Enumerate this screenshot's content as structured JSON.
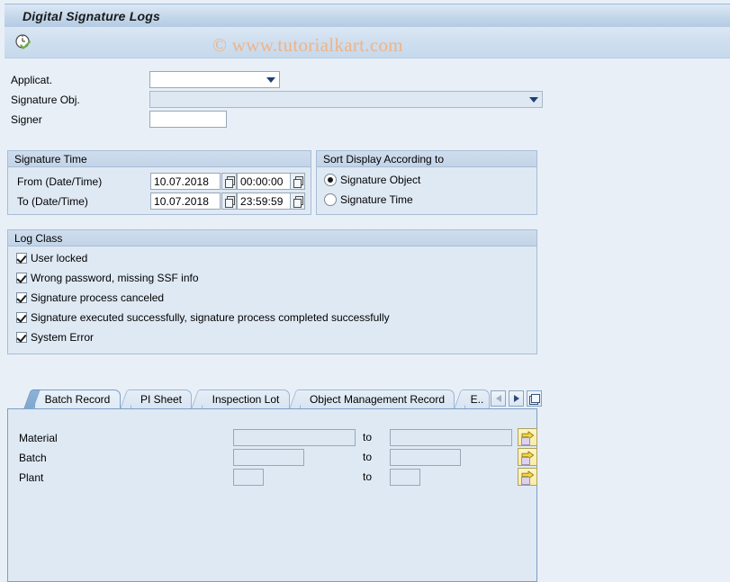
{
  "window": {
    "title": "Digital Signature Logs"
  },
  "toolbar": {
    "execute_icon": "clock-check-icon",
    "execute_tooltip": "Execute"
  },
  "watermark": {
    "text": "© www.tutorialkart.com"
  },
  "selection_form": {
    "rows": [
      {
        "label": "Applicat.",
        "value": "",
        "control": "dropdown",
        "enabled": true
      },
      {
        "label": "Signature Obj.",
        "value": "",
        "control": "dropdown",
        "enabled": false
      },
      {
        "label": "Signer",
        "value": "",
        "control": "input",
        "enabled": true
      }
    ]
  },
  "signature_time": {
    "title": "Signature Time",
    "rows": [
      {
        "label": "From (Date/Time)",
        "date": "10.07.2018",
        "time": "00:00:00"
      },
      {
        "label": "To (Date/Time)",
        "date": "10.07.2018",
        "time": "23:59:59"
      }
    ],
    "value_help_icon": "value-help-icon"
  },
  "sort_display": {
    "title": "Sort Display According to",
    "options": [
      {
        "label": "Signature Object",
        "selected": true
      },
      {
        "label": "Signature Time",
        "selected": false
      }
    ]
  },
  "log_class": {
    "title": "Log Class",
    "items": [
      {
        "label": "User locked",
        "checked": true
      },
      {
        "label": "Wrong password, missing SSF info",
        "checked": true
      },
      {
        "label": "Signature process canceled",
        "checked": true
      },
      {
        "label": "Signature executed successfully, signature process completed successfully",
        "checked": true
      },
      {
        "label": "System Error",
        "checked": true
      }
    ]
  },
  "tabstrip": {
    "tabs": [
      {
        "label": "Batch Record",
        "active": true
      },
      {
        "label": "PI Sheet",
        "active": false
      },
      {
        "label": "Inspection Lot",
        "active": false
      },
      {
        "label": "Object Management Record",
        "active": false
      },
      {
        "label": "E..",
        "active": false
      }
    ],
    "nav": {
      "prev_icon": "chevron-left-icon",
      "next_icon": "chevron-right-icon",
      "list_icon": "tab-list-icon"
    }
  },
  "tab_panel": {
    "to_label": "to",
    "multi_select_icon": "multiple-selection-icon",
    "rows": [
      {
        "label": "Material",
        "from": "",
        "to": ""
      },
      {
        "label": "Batch",
        "from": "",
        "to": ""
      },
      {
        "label": "Plant",
        "from": "",
        "to": ""
      }
    ]
  }
}
